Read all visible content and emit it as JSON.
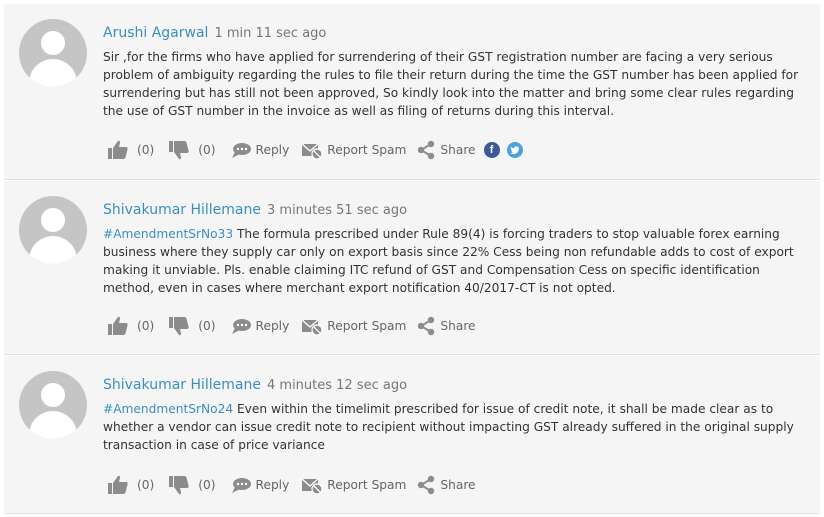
{
  "colors": {
    "link": "#3a8fbf",
    "panel": "#f5f5f5",
    "icon": "#8c8c8c"
  },
  "comments": [
    {
      "author": "Arushi Agarwal",
      "time": "1 min 11 sec ago",
      "hashtag": "",
      "text": "Sir ,for the firms who have applied for surrendering of their GST registration number are facing a very serious problem of ambiguity regarding the rules to file their return during the time the GST number has been applied for surrendering but has still not been approved, So kindly look into the matter and bring some clear rules regarding the use of GST number in the invoice as well as filing of returns during this interval.",
      "likes": "(0)",
      "dislikes": "(0)",
      "reply": "Reply",
      "report": "Report Spam",
      "share": "Share",
      "social_icons": [
        "facebook-icon",
        "twitter-icon"
      ]
    },
    {
      "author": "Shivakumar Hillemane",
      "time": "3 minutes 51 sec ago",
      "hashtag": "#AmendmentSrNo33",
      "text": " The formula prescribed under Rule 89(4) is forcing traders to stop valuable forex earning business where they supply car only on export basis since 22% Cess being non refundable adds to cost of export making it unviable. Pls. enable claiming ITC refund of GST and Compensation Cess on specific identification method, even in cases where merchant export notification 40/2017-CT is not opted.",
      "likes": "(0)",
      "dislikes": "(0)",
      "reply": "Reply",
      "report": "Report Spam",
      "share": "Share"
    },
    {
      "author": "Shivakumar Hillemane",
      "time": "4 minutes 12 sec ago",
      "hashtag": "#AmendmentSrNo24",
      "text": " Even within the timelimit prescribed for issue of credit note, it shall be made clear as to whether a vendor can issue credit note to recipient without impacting GST already suffered in the original supply transaction in case of price variance",
      "likes": "(0)",
      "dislikes": "(0)",
      "reply": "Reply",
      "report": "Report Spam",
      "share": "Share"
    }
  ]
}
